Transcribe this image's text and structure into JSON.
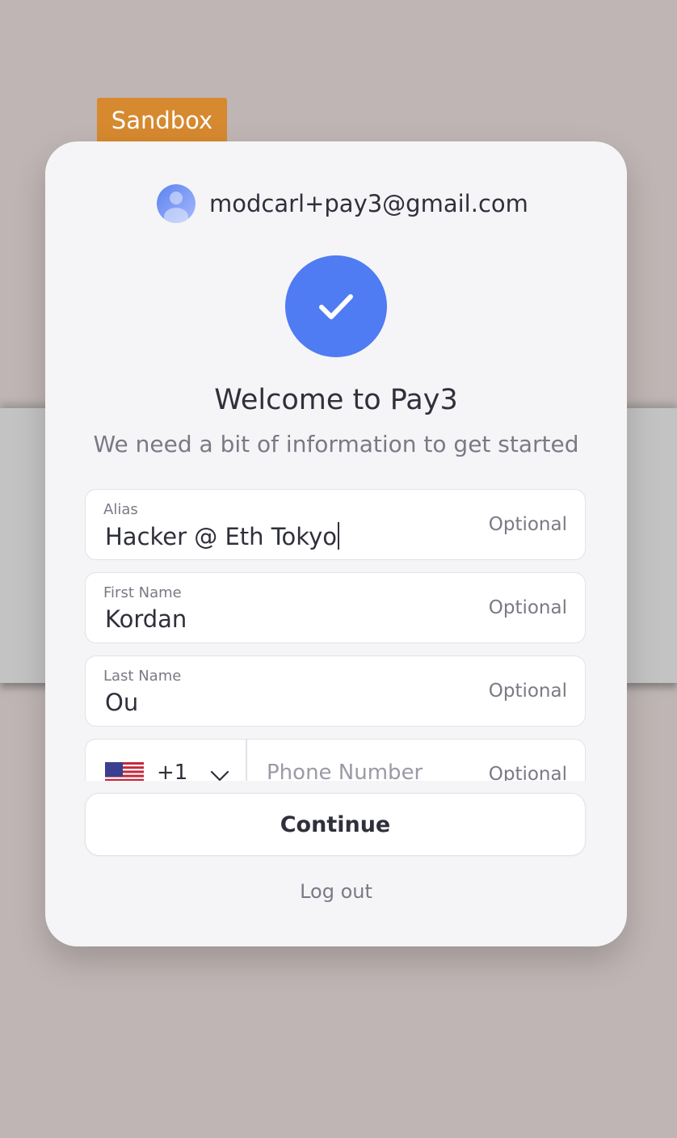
{
  "badge": {
    "label": "Sandbox",
    "color": "#d6892f"
  },
  "account": {
    "email": "modcarl+pay3@gmail.com",
    "avatar_icon": "user-avatar-icon"
  },
  "status": {
    "icon": "checkmark-icon",
    "color": "#4f7bf3"
  },
  "header": {
    "title": "Welcome to Pay3",
    "subtitle": "We need a bit of information to get started"
  },
  "form": {
    "alias": {
      "label": "Alias",
      "value": "Hacker @ Eth Tokyo",
      "hint": "Optional"
    },
    "first_name": {
      "label": "First Name",
      "value": "Kordan",
      "hint": "Optional"
    },
    "last_name": {
      "label": "Last Name",
      "value": "Ou",
      "hint": "Optional"
    },
    "phone": {
      "country_flag": "us-flag-icon",
      "country_code": "+1",
      "placeholder": "Phone Number",
      "value": "",
      "hint": "Optional"
    }
  },
  "actions": {
    "continue_label": "Continue",
    "logout_label": "Log out"
  }
}
